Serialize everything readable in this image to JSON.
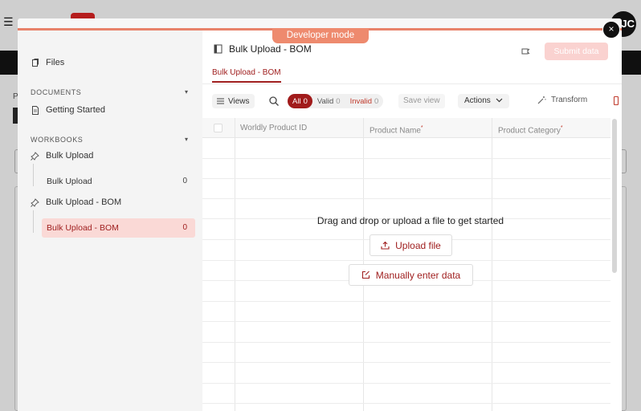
{
  "background": {
    "avatar_initials": "JC",
    "crumb_text": "P"
  },
  "modal": {
    "developer_badge": "Developer mode",
    "close_label": "×"
  },
  "sidebar": {
    "files_label": "Files",
    "documents_section": "DOCUMENTS",
    "documents": [
      {
        "label": "Getting Started"
      }
    ],
    "workbooks_section": "WORKBOOKS",
    "workbooks": [
      {
        "label": "Bulk Upload",
        "sheets": [
          {
            "label": "Bulk Upload",
            "count": "0"
          }
        ]
      },
      {
        "label": "Bulk Upload - BOM",
        "sheets": [
          {
            "label": "Bulk Upload - BOM",
            "count": "0",
            "active": true
          }
        ]
      }
    ]
  },
  "main": {
    "sheet_title": "Bulk Upload - BOM",
    "submit_label": "Submit data",
    "active_tab": "Bulk Upload - BOM",
    "toolbar": {
      "views_label": "Views",
      "filters": {
        "all_label": "All",
        "all_count": "0",
        "valid_label": "Valid",
        "valid_count": "0",
        "invalid_label": "Invalid",
        "invalid_count": "0"
      },
      "save_view_label": "Save view",
      "actions_label": "Actions",
      "transform_label": "Transform"
    },
    "columns": [
      {
        "label": "Worldly Product ID",
        "required": false
      },
      {
        "label": "Product Name",
        "required": true
      },
      {
        "label": "Product Category",
        "required": true
      }
    ],
    "empty_state": {
      "message": "Drag and drop or upload a file to get started",
      "upload_label": "Upload file",
      "manual_label": "Manually enter data"
    }
  },
  "colors": {
    "accent": "#a02020",
    "developer_badge": "#ee8a6e",
    "submit_disabled": "#fad2d0",
    "active_sidebar_bg": "#fad9d6"
  }
}
